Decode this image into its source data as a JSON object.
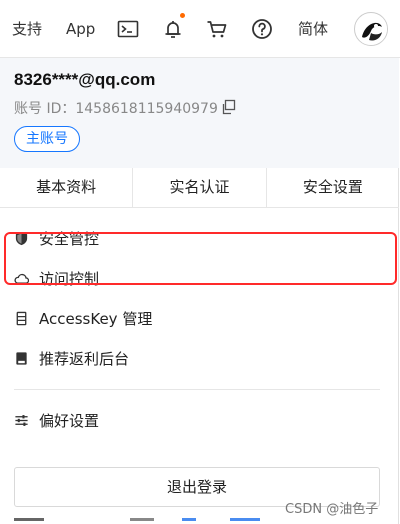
{
  "topbar": {
    "support_label": "支持",
    "app_label": "App",
    "lang_label": "简体",
    "icons": [
      "terminal-icon",
      "bell-icon",
      "cart-icon",
      "help-icon"
    ],
    "notify_dot_color": "#ff6a00"
  },
  "account": {
    "email": "8326****@qq.com",
    "id_label": "账号 ID：1458618115940979",
    "badge": "主账号"
  },
  "tabs": [
    {
      "label": "基本资料"
    },
    {
      "label": "实名认证"
    },
    {
      "label": "安全设置"
    }
  ],
  "menu": [
    {
      "label": "安全管控",
      "icon": "shield-icon"
    },
    {
      "label": "访问控制",
      "icon": "cloud-icon"
    },
    {
      "label": "AccessKey 管理",
      "icon": "key-icon"
    },
    {
      "label": "推荐返利后台",
      "icon": "gift-icon"
    },
    {
      "label": "偏好设置",
      "icon": "sliders-icon"
    }
  ],
  "logout_label": "退出登录",
  "watermark": "CSDN @油色子",
  "colors": {
    "accent": "#1677ff",
    "highlight": "#ff2a2a"
  }
}
